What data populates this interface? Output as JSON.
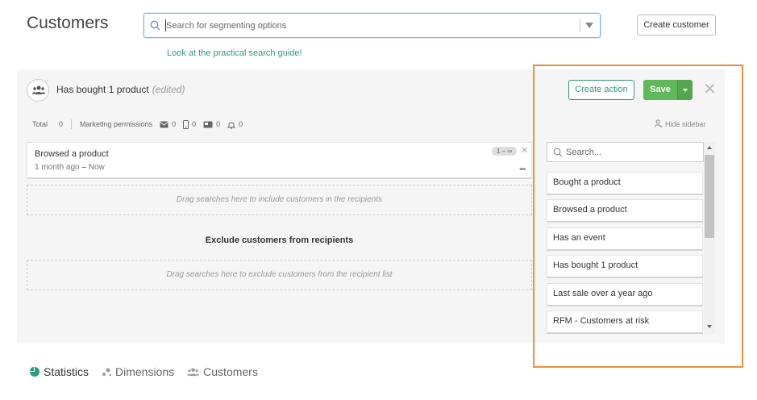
{
  "page": {
    "title": "Customers"
  },
  "search": {
    "placeholder": "Search for segmenting options",
    "guide_link": "Look at the practical search guide!"
  },
  "header": {
    "create_customer": "Create customer"
  },
  "segment": {
    "title": "Has bought 1 product",
    "edited": "(edited)",
    "stats": {
      "total_label": "Total",
      "total": "0",
      "marketing_label": "Marketing permissions",
      "email": "0",
      "sms": "0",
      "push": "0",
      "notif": "0"
    },
    "search_card": {
      "name": "Browsed a product",
      "range_from": "1 month ago",
      "range_sep": " – ",
      "range_to": "Now",
      "badge": "1 – ∞",
      "more": "•••"
    },
    "include_drop": "Drag searches here to include customers in the recipients",
    "exclude_title": "Exclude customers from recipients",
    "exclude_drop": "Drag searches here to exclude customers from the recipient list"
  },
  "actions": {
    "create_action": "Create action",
    "save": "Save",
    "close": "✕"
  },
  "sidebar": {
    "hide_label": "Hide sidebar",
    "search_placeholder": "Search...",
    "items": [
      {
        "label": "Bought a product"
      },
      {
        "label": "Browsed a product"
      },
      {
        "label": "Has an event"
      },
      {
        "label": "Has bought 1 product"
      },
      {
        "label": "Last sale over a year ago"
      },
      {
        "label": "RFM - Customers at risk"
      }
    ]
  },
  "tabs": [
    {
      "label": "Statistics",
      "icon": "pie-chart-icon"
    },
    {
      "label": "Dimensions",
      "icon": "dimensions-icon"
    },
    {
      "label": "Customers",
      "icon": "users-icon"
    }
  ],
  "colors": {
    "accent": "#2e9a7e",
    "save": "#5fb85c",
    "highlight": "#ef8d3a",
    "focus": "#7db3e8"
  }
}
